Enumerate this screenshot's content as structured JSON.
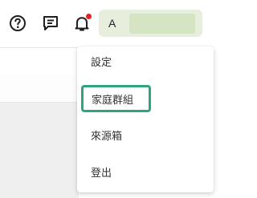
{
  "header": {
    "icons": {
      "help": "help-circle-icon",
      "feedback": "feedback-message-icon",
      "notifications": "bell-icon"
    },
    "notification_dot_color": "#e02424",
    "account": {
      "initial": "A",
      "chip_color": "#e7efdc"
    }
  },
  "account_menu": {
    "items": [
      {
        "label": "設定"
      },
      {
        "label": "家庭群組",
        "highlighted": true
      },
      {
        "label": "來源箱"
      },
      {
        "label": "登出"
      }
    ],
    "highlight_color": "#2da57f"
  }
}
